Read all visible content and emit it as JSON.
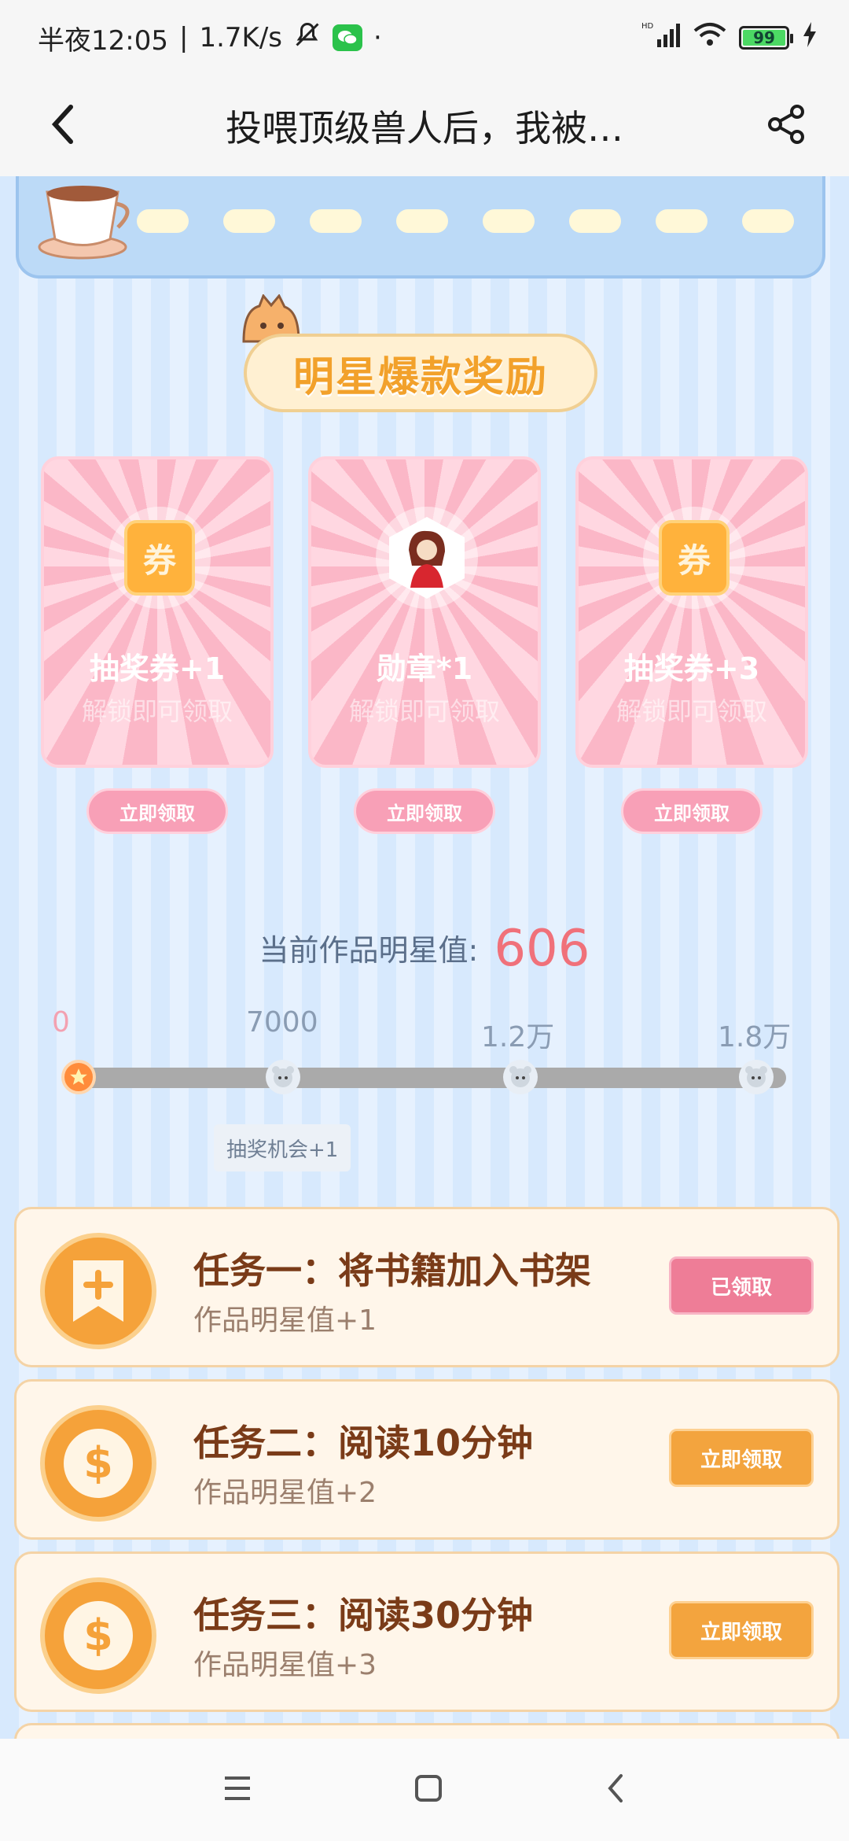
{
  "status_bar": {
    "time": "半夜12:05",
    "speed": "1.7K/s",
    "extra": "·",
    "battery": "99",
    "network": "HD"
  },
  "header": {
    "title": "投喂顶级兽人后，我被…"
  },
  "section": {
    "title": "明星爆款奖励"
  },
  "rewards": [
    {
      "icon_text": "券",
      "label": "抽奖券+1",
      "sub": "解锁即可领取",
      "button": "立即领取"
    },
    {
      "icon_text": "",
      "label": "勋章*1",
      "sub": "解锁即可领取",
      "button": "立即领取"
    },
    {
      "icon_text": "券",
      "label": "抽奖券+3",
      "sub": "解锁即可领取",
      "button": "立即领取"
    }
  ],
  "star": {
    "label": "当前作品明星值:",
    "value": "606",
    "progress_fraction": 0.0
  },
  "milestones": [
    "0",
    "7000",
    "1.2万",
    "1.8万"
  ],
  "lottery_tag": "抽奖机会+1",
  "tasks": [
    {
      "name": "任务一：将书籍加入书架",
      "sub": "作品明星值+1",
      "button": "已领取",
      "state": "done"
    },
    {
      "name": "任务二：阅读10分钟",
      "sub": "作品明星值+2",
      "button": "立即领取",
      "state": "go"
    },
    {
      "name": "任务三：阅读30分钟",
      "sub": "作品明星值+3",
      "button": "立即领取",
      "state": "go"
    }
  ],
  "colors": {
    "accent_pink": "#f0717a",
    "task_orange": "#f3a43e",
    "claimed_pink": "#ee7d97"
  },
  "icons": [
    "back-icon",
    "share-icon",
    "bookmark-plus-icon",
    "dollar-coin-icon",
    "menu-icon",
    "home-icon",
    "nav-back-icon"
  ]
}
